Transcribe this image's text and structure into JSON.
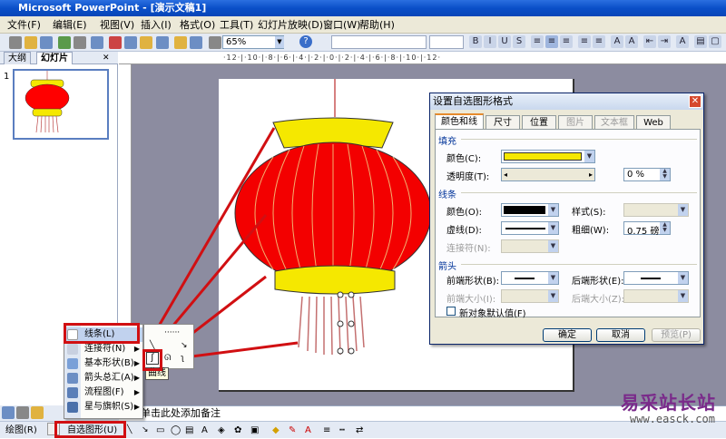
{
  "window": {
    "title": "Microsoft PowerPoint - [演示文稿1]"
  },
  "menubar": {
    "items": [
      "文件(F)",
      "编辑(E)",
      "视图(V)",
      "插入(I)",
      "格式(O)",
      "工具(T)",
      "幻灯片放映(D)",
      "窗口(W)",
      "帮助(H)"
    ]
  },
  "toolbar": {
    "zoom": "65%"
  },
  "panel": {
    "tabs": [
      "大纲",
      "幻灯片"
    ],
    "slide_number": "1"
  },
  "ruler": {
    "marks": "·12·|·10·|·8·|·6·|·4·|·2·|·0·|·2·|·4·|·6·|·8·|·10·|·12·"
  },
  "notes": {
    "placeholder": "单击此处添加备注"
  },
  "dialog": {
    "title": "设置自选图形格式",
    "tabs": [
      "颜色和线条",
      "尺寸",
      "位置",
      "图片",
      "文本框",
      "Web"
    ],
    "fill": {
      "section": "填充",
      "color_label": "颜色(C):",
      "color_value": "#f5e800",
      "transparency_label": "透明度(T):",
      "transparency_value": "0 %"
    },
    "line": {
      "section": "线条",
      "color_label": "颜色(O):",
      "style_label": "样式(S):",
      "dash_label": "虚线(D):",
      "weight_label": "粗细(W):",
      "weight_value": "0.75 磅",
      "connector_label": "连接符(N):"
    },
    "arrows": {
      "section": "箭头",
      "begin_style_label": "前端形状(B):",
      "end_style_label": "后端形状(E):",
      "begin_size_label": "前端大小(I):",
      "end_size_label": "后端大小(Z):"
    },
    "default_checkbox": "新对象默认值(F)",
    "buttons": {
      "ok": "确定",
      "cancel": "取消",
      "preview": "预览(P)"
    }
  },
  "context_menu": {
    "items": [
      {
        "label": "线条(L)",
        "arrow": "›"
      },
      {
        "label": "连接符(N)",
        "arrow": "▶"
      },
      {
        "label": "基本形状(B)",
        "arrow": "▶"
      },
      {
        "label": "箭头总汇(A)",
        "arrow": "▶"
      },
      {
        "label": "流程图(F)",
        "arrow": "▶"
      },
      {
        "label": "星与旗帜(S)",
        "arrow": "▶"
      }
    ]
  },
  "tooltip": {
    "curve": "曲线"
  },
  "drawing_toolbar": {
    "draw": "绘图(R)",
    "autoshapes": "自选图形(U)"
  },
  "watermark": {
    "cn": "易采站长站",
    "url": "www.easck.com"
  }
}
